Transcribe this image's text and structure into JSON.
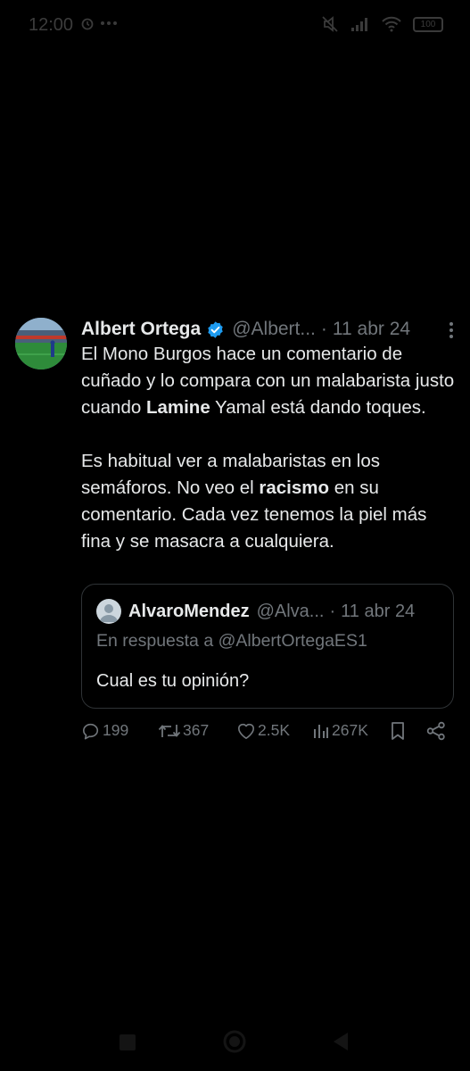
{
  "status_bar": {
    "time": "12:00",
    "battery": "100"
  },
  "tweet": {
    "author_name": "Albert Ortega",
    "handle": "@Albert...",
    "separator": "·",
    "date": "11 abr 24",
    "paragraph1": {
      "part1": "El Mono Burgos hace un comentario de cuñado y lo compara con un malabarista justo cuando ",
      "bold1": "Lamine",
      "part2": " Yamal está dando toques."
    },
    "paragraph2": {
      "part1": "Es habitual ver a malabaristas en los semáforos. No veo el ",
      "bold1": "racismo",
      "part2": " en su comentario. Cada vez tenemos la piel más fina y se masacra a cualquiera."
    },
    "quoted": {
      "author_name": "AlvaroMendez",
      "handle": "@Alva...",
      "separator": "·",
      "date": "11 abr 24",
      "reply_to": "En respuesta a @AlbertOrtegaES1",
      "text": "Cual es tu opinión?"
    },
    "actions": {
      "replies": "199",
      "retweets": "367",
      "likes": "2.5K",
      "views": "267K"
    }
  },
  "colors": {
    "background": "#000000",
    "text_primary": "#e7e9ea",
    "text_secondary": "#71767b",
    "verified": "#1d9bf0",
    "border": "#2f3336"
  }
}
